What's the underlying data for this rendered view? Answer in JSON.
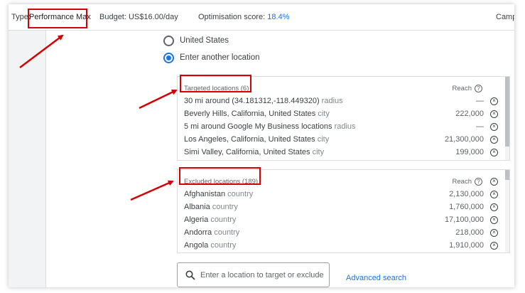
{
  "topbar": {
    "type_label": "Type:",
    "type_value": "Performance Max",
    "budget": "Budget: US$16.00/day",
    "opt_label": "Optimisation score:",
    "opt_value": "18.4%",
    "campaign_truncated": "Camp"
  },
  "location_options": [
    {
      "label": "United States",
      "selected": false
    },
    {
      "label": "Enter another location",
      "selected": true
    }
  ],
  "targeted": {
    "title": "Targeted locations (6)",
    "reach_label": "Reach",
    "rows": [
      {
        "name": "30 mi around (34.181312,-118.449320)",
        "kind": "radius",
        "reach": "—"
      },
      {
        "name": "Beverly Hills, California, United States",
        "kind": "city",
        "reach": "222,000"
      },
      {
        "name": "5 mi around Google My Business locations",
        "kind": "radius",
        "reach": "—"
      },
      {
        "name": "Los Angeles, California, United States",
        "kind": "city",
        "reach": "21,300,000"
      },
      {
        "name": "Simi Valley, California, United States",
        "kind": "city",
        "reach": "199,000"
      }
    ]
  },
  "excluded": {
    "title": "Excluded locations (189)",
    "reach_label": "Reach",
    "rows": [
      {
        "name": "Afghanistan",
        "kind": "country",
        "reach": "2,130,000"
      },
      {
        "name": "Albania",
        "kind": "country",
        "reach": "1,760,000"
      },
      {
        "name": "Algeria",
        "kind": "country",
        "reach": "17,100,000"
      },
      {
        "name": "Andorra",
        "kind": "country",
        "reach": "218,000"
      },
      {
        "name": "Angola",
        "kind": "country",
        "reach": "1,910,000"
      }
    ]
  },
  "search": {
    "placeholder": "Enter a location to target or exclude",
    "advanced_link": "Advanced search"
  },
  "colors": {
    "accent": "#1a73e8",
    "annotation_red": "#d50000"
  }
}
